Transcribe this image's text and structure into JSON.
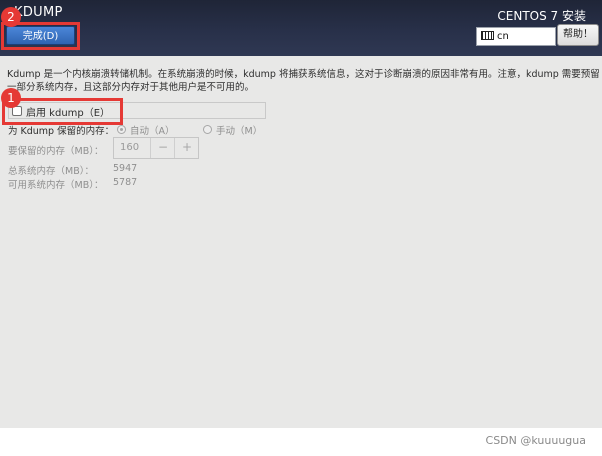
{
  "header": {
    "title": "KDUMP",
    "done_button": "完成(D)",
    "product": "CENTOS 7 安装",
    "keyboard_layout": "cn",
    "help_button": "帮助！"
  },
  "content": {
    "description_line1": "Kdump 是一个内核崩溃转储机制。在系统崩溃的时候，kdump 将捕获系统信息，这对于诊断崩溃的原因非常有用。注意，kdump 需要预留",
    "description_line2": "一部分系统内存，且这部分内存对于其他用户是不可用的。",
    "enable_kdump_label": "启用 kdump（E）",
    "enable_kdump_checked": false,
    "reserve_label": "为 Kdump 保留的内存：",
    "auto_option": "自动（A）",
    "manual_option": "手动（M）",
    "selected_option": "auto",
    "reserve_amount_label": "要保留的内存（MB）：",
    "reserve_amount_value": "160",
    "minus_label": "−",
    "plus_label": "+",
    "total_memory_label": "总系统内存（MB）：",
    "total_memory_value": "5947",
    "usable_memory_label": "可用系统内存（MB）：",
    "usable_memory_value": "5787"
  },
  "annotations": {
    "badge_1": "1",
    "badge_2": "2",
    "color": "#e53935"
  },
  "watermark": "CSDN @kuuuugua"
}
